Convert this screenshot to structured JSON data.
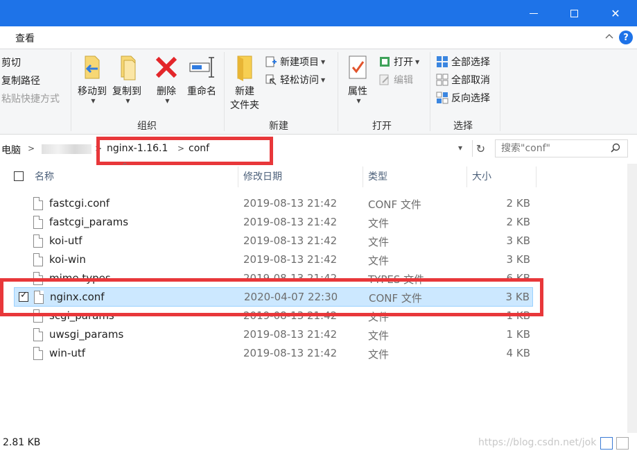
{
  "window": {
    "minimize_label": "",
    "maximize_label": "",
    "close_label": "✕"
  },
  "menu": {
    "view_tab": "查看",
    "collapse_glyph": "^",
    "help_glyph": "?"
  },
  "ribbon": {
    "clipboard": {
      "cut": "剪切",
      "copy_path": "复制路径",
      "paste_shortcut": "粘贴快捷方式"
    },
    "organize": {
      "label": "组织",
      "move_to": "移动到",
      "copy_to": "复制到",
      "delete": "删除",
      "rename": "重命名"
    },
    "new": {
      "label": "新建",
      "new_folder_line1": "新建",
      "new_folder_line2": "文件夹",
      "new_item": "新建项目",
      "easy_access": "轻松访问"
    },
    "open": {
      "label": "打开",
      "properties": "属性",
      "open": "打开",
      "edit": "编辑"
    },
    "select": {
      "label": "选择",
      "select_all": "全部选择",
      "select_none": "全部取消",
      "invert": "反向选择"
    }
  },
  "address": {
    "root": "电脑",
    "crumbs": [
      "nginx-1.16.1",
      "conf"
    ],
    "search_placeholder": "搜索\"conf\""
  },
  "columns": {
    "name": "名称",
    "modified": "修改日期",
    "type": "类型",
    "size": "大小"
  },
  "files": [
    {
      "name": "fastcgi.conf",
      "date": "2019-08-13 21:42",
      "type": "CONF 文件",
      "size": "2 KB",
      "selected": false
    },
    {
      "name": "fastcgi_params",
      "date": "2019-08-13 21:42",
      "type": "文件",
      "size": "2 KB",
      "selected": false
    },
    {
      "name": "koi-utf",
      "date": "2019-08-13 21:42",
      "type": "文件",
      "size": "3 KB",
      "selected": false
    },
    {
      "name": "koi-win",
      "date": "2019-08-13 21:42",
      "type": "文件",
      "size": "3 KB",
      "selected": false
    },
    {
      "name": "mime.types",
      "date": "2019-08-13 21:42",
      "type": "TYPES 文件",
      "size": "6 KB",
      "selected": false
    },
    {
      "name": "nginx.conf",
      "date": "2020-04-07 22:30",
      "type": "CONF 文件",
      "size": "3 KB",
      "selected": true
    },
    {
      "name": "scgi_params",
      "date": "2019-08-13 21:42",
      "type": "文件",
      "size": "1 KB",
      "selected": false
    },
    {
      "name": "uwsgi_params",
      "date": "2019-08-13 21:42",
      "type": "文件",
      "size": "1 KB",
      "selected": false
    },
    {
      "name": "win-utf",
      "date": "2019-08-13 21:42",
      "type": "文件",
      "size": "4 KB",
      "selected": false
    }
  ],
  "status": {
    "selection_size": "2.81 KB",
    "watermark": "https://blog.csdn.net/jok"
  },
  "colors": {
    "titlebar": "#1e73e8",
    "highlight_box": "#e8373a",
    "selection": "#cce8ff"
  }
}
